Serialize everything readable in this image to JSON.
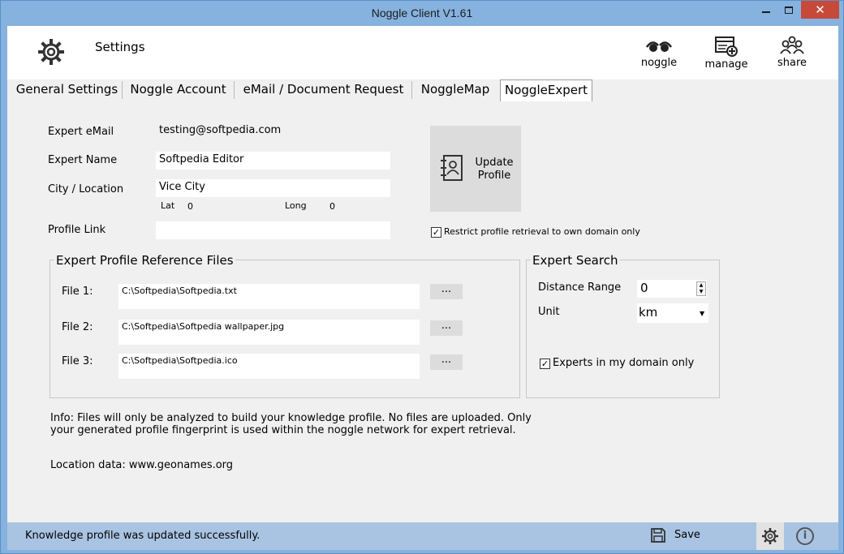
{
  "window": {
    "title": "Noggle Client V1.61",
    "close_glyph": "✕"
  },
  "header": {
    "title": "Settings",
    "buttons": [
      {
        "label": "noggle",
        "icon": "eyes-icon"
      },
      {
        "label": "manage",
        "icon": "manage-list-icon"
      },
      {
        "label": "share",
        "icon": "people-share-icon"
      }
    ]
  },
  "tabs": [
    {
      "label": "General Settings",
      "active": false
    },
    {
      "label": "Noggle Account",
      "active": false
    },
    {
      "label": "eMail / Document Request",
      "active": false
    },
    {
      "label": "NoggleMap",
      "active": false
    },
    {
      "label": "NoggleExpert",
      "active": true
    }
  ],
  "form": {
    "email_label": "Expert eMail",
    "email_value": "testing@softpedia.com",
    "name_label": "Expert Name",
    "name_value": "Softpedia Editor",
    "city_label": "City / Location",
    "city_value": "Vice City",
    "lat_label": "Lat",
    "lat_value": "0",
    "long_label": "Long",
    "long_value": "0",
    "profile_link_label": "Profile Link",
    "profile_link_value": "",
    "update_profile_label": "Update Profile",
    "restrict_label": "Restrict profile retrieval to own domain only",
    "restrict_checked": true
  },
  "reference_files": {
    "title": "Expert Profile Reference Files",
    "browse_label": "...",
    "files": [
      {
        "label": "File 1:",
        "path": "C:\\Softpedia\\Softpedia.txt"
      },
      {
        "label": "File 2:",
        "path": "C:\\Softpedia\\Softpedia wallpaper.jpg"
      },
      {
        "label": "File 3:",
        "path": "C:\\Softpedia\\Softpedia.ico"
      }
    ]
  },
  "expert_search": {
    "title": "Expert Search",
    "distance_label": "Distance Range",
    "distance_value": "0",
    "unit_label": "Unit",
    "unit_value": "km",
    "domain_only_label": "Experts in my domain only",
    "domain_only_checked": true
  },
  "info": {
    "line1": "Info: Files will only be analyzed to build your knowledge profile. No files are uploaded. Only",
    "line2": "your generated profile fingerprint is used within the noggle network for expert retrieval.",
    "location_data": "Location data: www.geonames.org"
  },
  "statusbar": {
    "message": "Knowledge profile was updated successfully.",
    "save_label": "Save",
    "info_glyph": "i"
  },
  "colors": {
    "titlebar": "#86b2df",
    "close": "#c7493a",
    "statusbar": "#a9c4e3",
    "panel": "#f0f0f0"
  }
}
